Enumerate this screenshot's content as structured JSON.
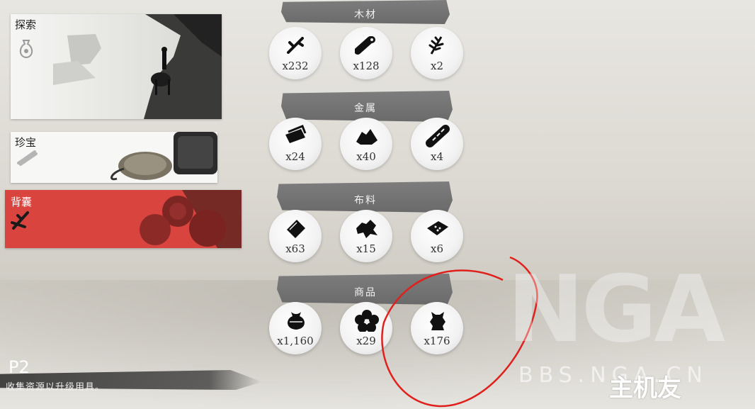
{
  "sidebar": {
    "items": [
      {
        "label": "探索"
      },
      {
        "label": "珍宝"
      },
      {
        "label": "背囊"
      }
    ]
  },
  "groups": [
    {
      "title": "木材",
      "items": [
        {
          "icon": "branch-icon",
          "count": "x232"
        },
        {
          "icon": "log-icon",
          "count": "x128"
        },
        {
          "icon": "plant-sprig-icon",
          "count": "x2"
        }
      ]
    },
    {
      "title": "金属",
      "items": [
        {
          "icon": "metal-plates-icon",
          "count": "x24"
        },
        {
          "icon": "ore-pile-icon",
          "count": "x40"
        },
        {
          "icon": "coin-string-icon",
          "count": "x4"
        }
      ]
    },
    {
      "title": "布料",
      "items": [
        {
          "icon": "cloth-square-icon",
          "count": "x63"
        },
        {
          "icon": "leather-hide-icon",
          "count": "x15"
        },
        {
          "icon": "silk-bundle-icon",
          "count": "x6"
        }
      ]
    },
    {
      "title": "商品",
      "items": [
        {
          "icon": "pouch-icon",
          "count": "x1,160"
        },
        {
          "icon": "flower-icon",
          "count": "x29"
        },
        {
          "icon": "armor-icon",
          "count": "x176"
        }
      ]
    }
  ],
  "footer": {
    "page": "P2",
    "hint": "收集资源以升级用具。"
  },
  "watermark": {
    "logo": "NGA",
    "site": "BBS.NGA.CN",
    "brand": "主机友"
  },
  "colors": {
    "selected_tab": "#d9443f",
    "header_band": "#707070",
    "annotation": "#e0201c"
  }
}
